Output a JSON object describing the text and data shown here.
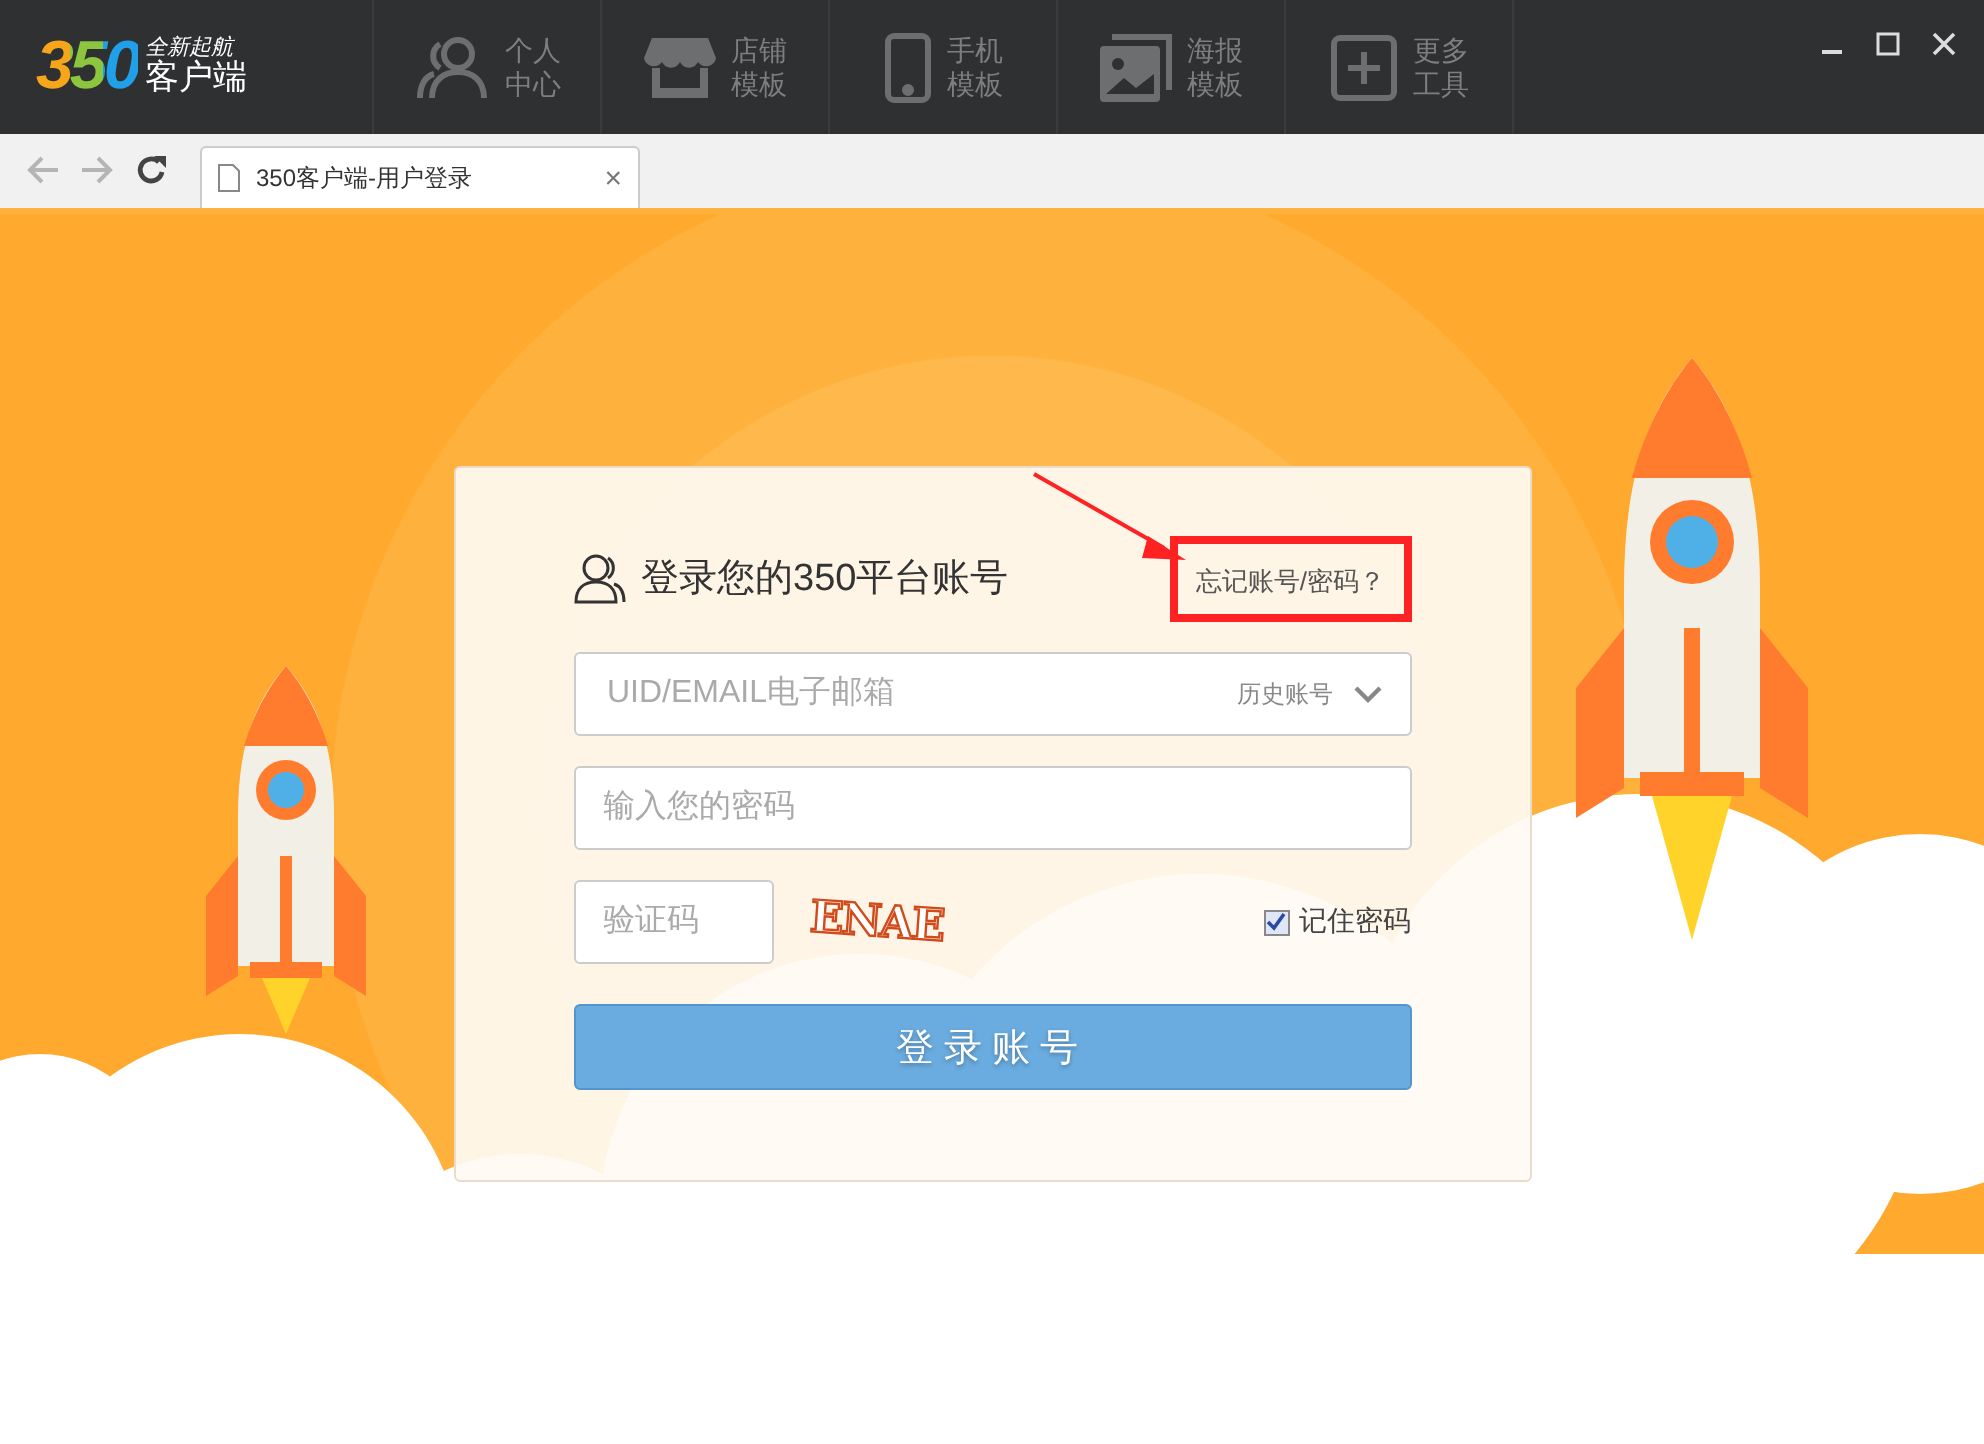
{
  "app": {
    "logo": "350",
    "tagline": "全新起航",
    "name": "客户端"
  },
  "nav": [
    {
      "kind": "person",
      "lines": [
        "个人",
        "中心"
      ]
    },
    {
      "kind": "store",
      "lines": [
        "店铺",
        "模板"
      ]
    },
    {
      "kind": "phone",
      "lines": [
        "手机",
        "模板"
      ]
    },
    {
      "kind": "poster",
      "lines": [
        "海报",
        "模板"
      ]
    },
    {
      "kind": "plus",
      "lines": [
        "更多",
        "工具"
      ]
    }
  ],
  "browser_tab": {
    "title": "350客户端-用户登录",
    "close": "×"
  },
  "login": {
    "title": "登录您的350平台账号",
    "forgot_link": "忘记账号/密码？",
    "username": {
      "placeholder": "UID/EMAIL电子邮箱",
      "history": "历史账号"
    },
    "password": {
      "placeholder": "输入您的密码"
    },
    "captcha": {
      "placeholder": "验证码",
      "code": "ENAE"
    },
    "remember": {
      "label": "记住密码",
      "checked": true
    },
    "submit": "登录账号"
  }
}
